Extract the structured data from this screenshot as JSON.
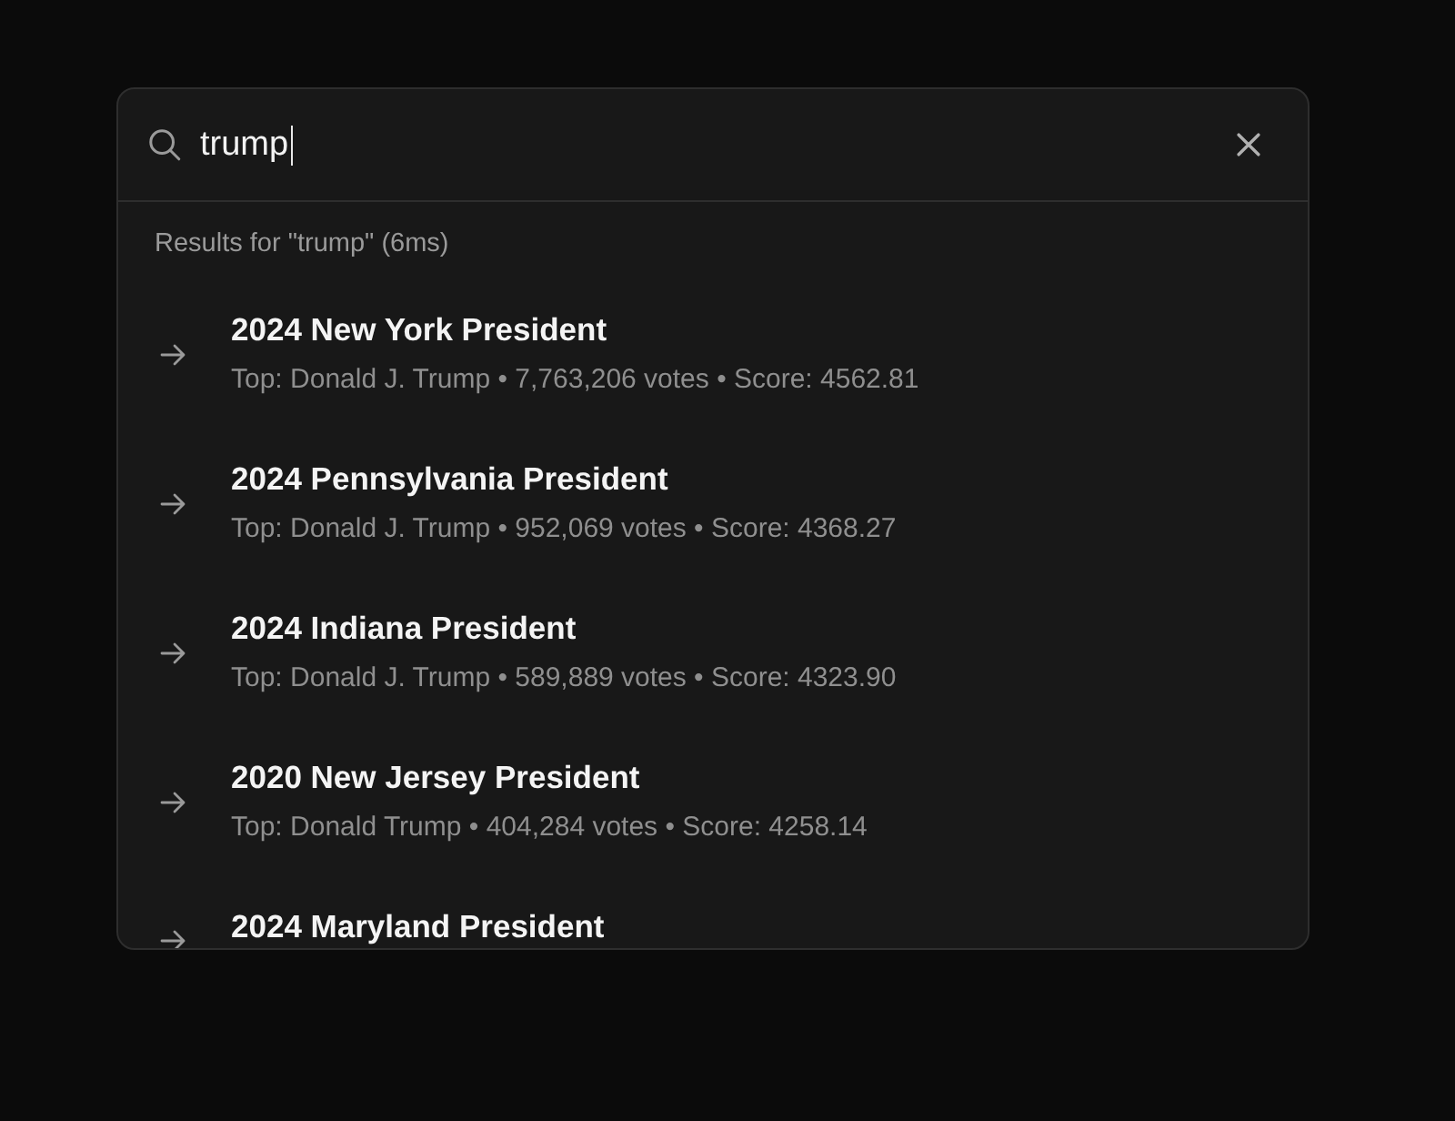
{
  "search": {
    "value": "trump"
  },
  "results_header": "Results for \"trump\" (6ms)",
  "results": [
    {
      "title": "2024 New York President",
      "subtitle": "Top: Donald J. Trump • 7,763,206 votes • Score: 4562.81",
      "selected": false
    },
    {
      "title": "2024 Pennsylvania President",
      "subtitle": "Top: Donald J. Trump • 952,069 votes • Score: 4368.27",
      "selected": false
    },
    {
      "title": "2024 Indiana President",
      "subtitle": "Top: Donald J. Trump • 589,889 votes • Score: 4323.90",
      "selected": false
    },
    {
      "title": "2020 New Jersey President",
      "subtitle": "Top: Donald Trump • 404,284 votes • Score: 4258.14",
      "selected": false
    },
    {
      "title": "2024 Maryland President",
      "selected": false
    }
  ]
}
